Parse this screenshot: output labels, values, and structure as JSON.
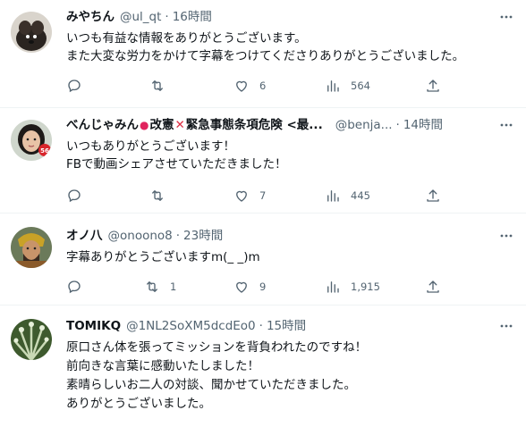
{
  "tweets": [
    {
      "name": "みやちん",
      "handle": "@ul_qt",
      "time": "16時間",
      "lines": [
        "いつも有益な情報をありがとうございます。",
        "また大変な労力をかけて字幕をつけてくださりありがとうございました。"
      ],
      "replies": "",
      "retweets": "",
      "likes": "6",
      "views": "564"
    },
    {
      "name_a": "べんじゃみん",
      "name_dot": "●",
      "name_b": "改憲",
      "name_x": "✕",
      "name_c": "緊急事態条項危険 <最...",
      "handle": "@benja...",
      "time": "14時間",
      "lines": [
        "いつもありがとうございます！",
        "FBで動画シェアさせていただきました！"
      ],
      "replies": "",
      "retweets": "",
      "likes": "7",
      "views": "445"
    },
    {
      "name": "オノ八",
      "handle": "@onoono8",
      "time": "23時間",
      "lines": [
        "字幕ありがとうございますm(_ _)m"
      ],
      "replies": "",
      "retweets": "1",
      "likes": "9",
      "views": "1,915"
    },
    {
      "name": "TOMIKQ",
      "handle": "@1NL2SoXM5dcdEo0",
      "time": "15時間",
      "lines": [
        "原口さん体を張ってミッションを背負われたのですね！",
        "前向きな言葉に感動いたしました！",
        "素晴らしいお二人の対談、聞かせていただきました。",
        "ありがとうございました。"
      ]
    }
  ],
  "separator": "·",
  "icons": {
    "reply": "reply-icon",
    "retweet": "retweet-icon",
    "like": "heart-icon",
    "views": "views-icon",
    "share": "share-icon",
    "more": "more-icon"
  },
  "colors": {
    "text": "#0f1419",
    "secondary": "#536471",
    "divider": "#eff3f4"
  }
}
